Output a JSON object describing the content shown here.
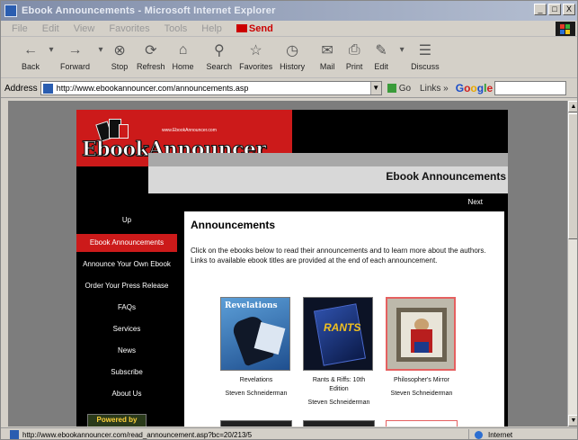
{
  "window": {
    "title": "Ebook Announcements - Microsoft Internet Explorer",
    "controls": [
      "_",
      "□",
      "X"
    ]
  },
  "menu": {
    "items": [
      "File",
      "Edit",
      "View",
      "Favorites",
      "Tools",
      "Help"
    ],
    "send_label": "Send"
  },
  "toolbar": {
    "buttons": [
      {
        "label": "Back",
        "icon": "back-arrow-icon",
        "glyph": "←"
      },
      {
        "label": "Forward",
        "icon": "forward-arrow-icon",
        "glyph": "→"
      },
      {
        "label": "Stop",
        "icon": "stop-icon",
        "glyph": "⊗"
      },
      {
        "label": "Refresh",
        "icon": "refresh-icon",
        "glyph": "⟳"
      },
      {
        "label": "Home",
        "icon": "home-icon",
        "glyph": "⌂"
      },
      {
        "label": "Search",
        "icon": "search-icon",
        "glyph": "⚲"
      },
      {
        "label": "Favorites",
        "icon": "favorites-icon",
        "glyph": "☆"
      },
      {
        "label": "History",
        "icon": "history-icon",
        "glyph": "◷"
      },
      {
        "label": "Mail",
        "icon": "mail-icon",
        "glyph": "✉"
      },
      {
        "label": "Print",
        "icon": "print-icon",
        "glyph": "⎙"
      },
      {
        "label": "Edit",
        "icon": "edit-icon",
        "glyph": "✎"
      },
      {
        "label": "Discuss",
        "icon": "discuss-icon",
        "glyph": "☰"
      }
    ]
  },
  "address": {
    "label": "Address",
    "url": "http://www.ebookannouncer.com/announcements.asp",
    "go_label": "Go",
    "links_label": "Links »",
    "google": [
      "G",
      "o",
      "o",
      "g",
      "l",
      "e"
    ]
  },
  "site": {
    "logo_url": "www.EbookAnnouncer.com",
    "wordmark": "EbookAnnouncer",
    "header_title": "Ebook Announcements",
    "next_label": "Next",
    "nav": [
      "Up",
      "Ebook Announcements",
      "Announce Your Own Ebook",
      "Order Your Press Release",
      "FAQs",
      "Services",
      "News",
      "Subscribe",
      "About Us"
    ],
    "active_nav": "Ebook Announcements",
    "powered_label": "Powered by"
  },
  "content": {
    "heading": "Announcements",
    "intro": "Click on the ebooks below to read their announcements and to learn more about the authors. Links to available ebook titles are provided at the end of each announcement.",
    "books": [
      {
        "title": "Revelations",
        "author": "Steven Schneiderman",
        "cover_text": "Revelations",
        "cover_color": "#2f6cb0"
      },
      {
        "title": "Rants & Riffs: 10th Edition",
        "author": "Steven Schneiderman",
        "cover_text": "RANTS",
        "cover_color": "#0d1a3a"
      },
      {
        "title": "Philosopher's Mirror",
        "author": "Steven Schneiderman",
        "cover_text": "",
        "cover_color": "#b7b4a6"
      }
    ]
  },
  "status": {
    "url": "http://www.ebookannouncer.com/read_announcement.asp?bc=20/213/5",
    "zone": "Internet"
  },
  "colors": {
    "brand_red": "#cc1a1a",
    "selected_border": "#e56060"
  }
}
